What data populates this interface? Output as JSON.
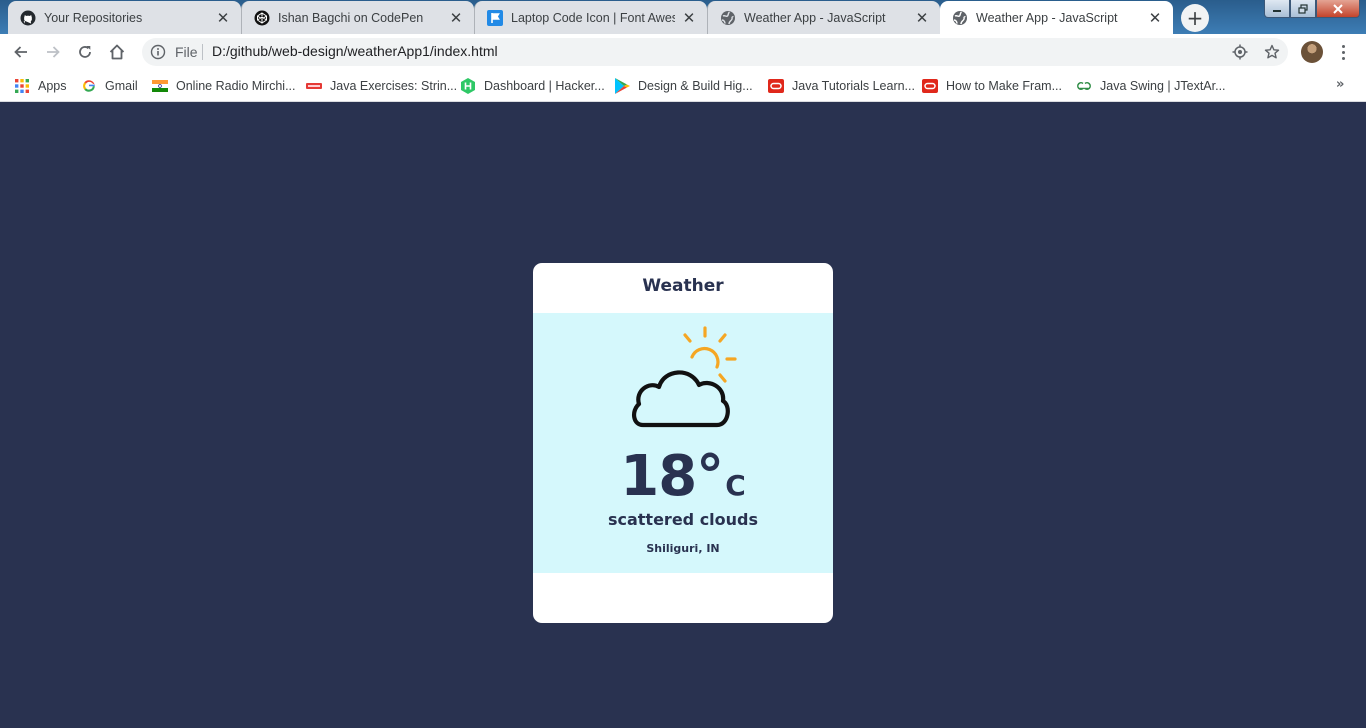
{
  "browser": {
    "tabs": [
      {
        "title": "Your Repositories",
        "icon": "github-icon",
        "active": false
      },
      {
        "title": "Ishan Bagchi on CodePen",
        "icon": "codepen-icon",
        "active": false
      },
      {
        "title": "Laptop Code Icon | Font Awesome",
        "icon": "font-awesome-flag-icon",
        "active": false
      },
      {
        "title": "Weather App - JavaScript",
        "icon": "globe-icon",
        "active": false
      },
      {
        "title": "Weather App - JavaScript",
        "icon": "globe-icon",
        "active": true
      }
    ],
    "new_tab_label": "+",
    "omnibox": {
      "scheme_label": "File",
      "url": "D:/github/web-design/weatherApp1/index.html"
    },
    "bookmarks": [
      {
        "label": "Apps",
        "icon": "apps-grid-icon"
      },
      {
        "label": "Gmail",
        "icon": "google-icon"
      },
      {
        "label": "Online Radio Mirchi...",
        "icon": "india-flag-icon"
      },
      {
        "label": "Java Exercises: Strin...",
        "icon": "w3resource-icon"
      },
      {
        "label": "Dashboard | Hacker...",
        "icon": "hackerrank-icon"
      },
      {
        "label": "Design & Build Hig...",
        "icon": "google-play-icon"
      },
      {
        "label": "Java Tutorials Learn...",
        "icon": "oracle-icon"
      },
      {
        "label": "How to Make Fram...",
        "icon": "oracle-icon"
      },
      {
        "label": "Java Swing | JTextAr...",
        "icon": "geeksforgeeks-icon"
      }
    ],
    "bookmarks_more_label": "»"
  },
  "weather": {
    "title": "Weather",
    "temperature": "18°",
    "unit": "C",
    "description": "scattered clouds",
    "location": "Shiliguri, IN",
    "icon": "partly-cloudy-icon"
  },
  "colors": {
    "page_background": "#293250",
    "card_background": "#ffffff",
    "weather_panel": "#d5f8fc",
    "text_primary": "#293250",
    "sun": "#f5a623"
  }
}
